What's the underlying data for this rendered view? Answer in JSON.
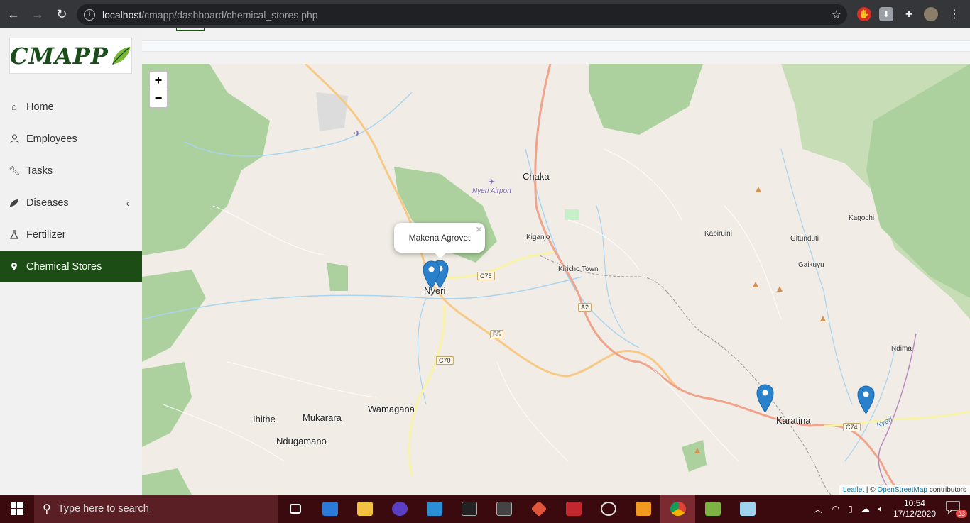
{
  "browser": {
    "url_host": "localhost",
    "url_path": "/cmapp/dashboard/chemical_stores.php"
  },
  "logo": {
    "text": "CMAPP"
  },
  "sidebar": {
    "items": [
      {
        "label": "Home",
        "icon": "home-icon"
      },
      {
        "label": "Employees",
        "icon": "user-icon"
      },
      {
        "label": "Tasks",
        "icon": "wrench-icon"
      },
      {
        "label": "Diseases",
        "icon": "leaf-icon"
      },
      {
        "label": "Fertilizer",
        "icon": "flask-icon"
      },
      {
        "label": "Chemical Stores",
        "icon": "map-marker-icon"
      }
    ],
    "active": "Chemical Stores"
  },
  "map": {
    "zoom_in": "+",
    "zoom_out": "−",
    "popup": {
      "text": "Makena Agrovet",
      "close": "×"
    },
    "places": [
      "Chaka",
      "Nyeri Airport",
      "Kiganjo",
      "Kiricho Town",
      "Nyeri",
      "Kabiruini",
      "Gitunduti",
      "Kagochi",
      "Gaikuyu",
      "Ndima",
      "Karatina",
      "Ihithe",
      "Mukarara",
      "Wamagana",
      "Ndugamano",
      "Nyeri"
    ],
    "roads": [
      "C75",
      "A2",
      "B5",
      "C70",
      "C74"
    ],
    "attribution": {
      "leaflet": "Leaflet",
      "sep": " | © ",
      "osm": "OpenStreetMap",
      "tail": " contributors"
    },
    "marker_color": "#2a81cb"
  },
  "taskbar": {
    "search_placeholder": "Type here to search",
    "time": "10:54",
    "date": "17/12/2020",
    "notifications": "23",
    "accent": "#3a0a0e"
  }
}
